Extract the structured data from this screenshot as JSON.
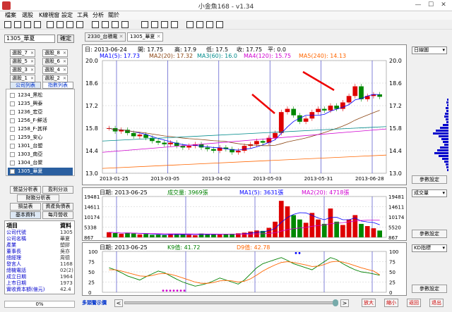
{
  "window": {
    "title": "小金魚168 - v1.34"
  },
  "menu": [
    "檔案",
    "選股",
    "K線視窗",
    "設定",
    "工具",
    "分析",
    "關於"
  ],
  "left": {
    "stock_input": "1305_華夏",
    "confirm": "確定",
    "groups": [
      "選股_7",
      "選股_8",
      "選股_5",
      "選股_6",
      "選股_3",
      "選股_4",
      "選股_1",
      "選股_2"
    ],
    "tab_company": "公司列表",
    "tab_index": "指數列表",
    "stocks": [
      "1234_黑松",
      "1235_興泰",
      "1236_宏亞",
      "1256_F-鮮活",
      "1258_F-其祥",
      "1259_安心",
      "1301_台塑",
      "1303_南亞",
      "1304_台聚",
      "1305_華夏"
    ],
    "buttons": [
      "營益分析表",
      "盈利分派",
      "財務分析表",
      "損益表",
      "資產負債表",
      "基本資料",
      "每月營收"
    ],
    "info_header": [
      "項目",
      "資料"
    ],
    "info_rows": [
      [
        "公司代號",
        "1305"
      ],
      [
        "公司名稱",
        "華夏"
      ],
      [
        "產業",
        "塑膠"
      ],
      [
        "董事長",
        "吳亦"
      ],
      [
        "總經理",
        "周德"
      ],
      [
        "發言人",
        "1168"
      ],
      [
        "總機電話",
        "02(2)"
      ],
      [
        "成立日期",
        "1964"
      ],
      [
        "上市日期",
        "1973"
      ],
      [
        "實收資本額(億元)",
        "42.4"
      ]
    ],
    "progress": "0%"
  },
  "tabs": [
    "2330_台積電",
    "1305_華夏"
  ],
  "price_chart": {
    "header": {
      "date": "日: 2013-06-24",
      "open": "開: 17.75",
      "high": "高: 17.9",
      "low": "低: 17.5",
      "close": "收: 17.75",
      "chg": "平: 0.0"
    },
    "ma": [
      "MA1(5): 17.73",
      "MA2(20): 17.32",
      "MA3(60): 16.0",
      "MA4(120): 15.75",
      "MA5(240): 14.13"
    ],
    "ma_colors": [
      "#0000ff",
      "#8b4513",
      "#008b8b",
      "#d000d0",
      "#ff6600"
    ],
    "y_ticks": [
      "20.0",
      "18.6",
      "17.2",
      "15.8",
      "14.4",
      "13.0"
    ],
    "x_ticks": [
      "2013-01-25",
      "2013-03-05",
      "2013-04-02",
      "2013-05-03",
      "2013-05-31",
      "2013-06-28"
    ]
  },
  "volume_chart": {
    "date": "日期: 2013-06-25",
    "vol": "成交量: 3969張",
    "ma1": "MA1(5): 3631張",
    "ma2": "MA2(20): 4718張",
    "y_left": [
      "19481",
      "14611",
      "10174",
      "5338",
      "867"
    ],
    "y_right": [
      "19481",
      "14611",
      "10174",
      "5520",
      "867"
    ]
  },
  "kd_chart": {
    "date": "日期: 2013-06-25",
    "k": "K9值: 41.72",
    "d": "D9值: 42.78",
    "y_ticks": [
      "100",
      "75",
      "50",
      "25",
      "0"
    ]
  },
  "right": {
    "sel1": "日線圖",
    "btn1": "參數設定",
    "sel2": "成交量",
    "btn2": "參數設定",
    "sel3": "KD指標",
    "btn3": "參數設定"
  },
  "bottom": {
    "label": "多頭警示價",
    "enlarge": "放大",
    "shrink": "縮小",
    "back": "返回",
    "exit": "退出"
  },
  "chart_data": [
    {
      "type": "candlestick",
      "x_range": [
        "2013-01-25",
        "2013-06-28"
      ],
      "ylim": [
        13.0,
        20.0
      ],
      "close_series": [
        15.8,
        15.6,
        15.7,
        15.5,
        15.3,
        15.4,
        15.2,
        15.0,
        14.9,
        14.8,
        14.9,
        14.7,
        14.6,
        14.7,
        14.8,
        14.6,
        14.5,
        14.4,
        14.6,
        14.5,
        14.3,
        14.4,
        14.7,
        14.8,
        15.0,
        14.9,
        15.2,
        15.5,
        16.8,
        17.0,
        16.6,
        16.2,
        16.4,
        16.8,
        17.0,
        16.9,
        17.2,
        17.0,
        17.4,
        17.8,
        18.4,
        17.6,
        17.8,
        17.9,
        17.75
      ]
    },
    {
      "type": "bar",
      "ylim": [
        867,
        19481
      ],
      "values": [
        3200,
        2800,
        2500,
        3000,
        2600,
        2200,
        2400,
        2000,
        2100,
        1900,
        2300,
        2500,
        2200,
        2000,
        1800,
        2600,
        2400,
        2200,
        2100,
        2300,
        2500,
        2700,
        3000,
        3500,
        4000,
        3800,
        5200,
        8000,
        17500,
        15000,
        11000,
        9000,
        7500,
        12000,
        9000,
        7000,
        14000,
        8000,
        6500,
        9000,
        11000,
        7000,
        6000,
        5000,
        3969
      ]
    },
    {
      "type": "line",
      "ylim": [
        0,
        100
      ],
      "series": [
        {
          "name": "K9",
          "values": [
            60,
            55,
            48,
            40,
            35,
            30,
            38,
            45,
            52,
            48,
            40,
            32,
            25,
            20,
            15,
            18,
            22,
            28,
            35,
            30,
            25,
            20,
            30,
            45,
            60,
            70,
            75,
            80,
            85,
            78,
            70,
            65,
            60,
            55,
            65,
            75,
            85,
            80,
            70,
            62,
            55,
            50,
            48,
            45,
            41.72
          ]
        },
        {
          "name": "D9",
          "values": [
            55,
            55,
            52,
            48,
            44,
            40,
            39,
            41,
            45,
            46,
            44,
            40,
            35,
            30,
            25,
            22,
            22,
            24,
            28,
            29,
            28,
            25,
            27,
            33,
            42,
            52,
            60,
            67,
            73,
            75,
            73,
            70,
            67,
            63,
            64,
            68,
            74,
            76,
            74,
            70,
            65,
            60,
            56,
            52,
            42.78
          ]
        }
      ]
    }
  ]
}
